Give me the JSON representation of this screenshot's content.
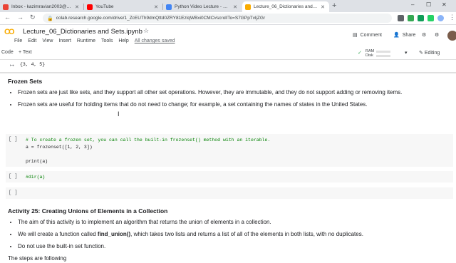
{
  "browser": {
    "tabs": [
      {
        "label": "Inbox - kazimravian2003@gmail...",
        "color": "#ea4335",
        "active": false
      },
      {
        "label": "YouTube",
        "color": "#ff0000",
        "active": false
      },
      {
        "label": "Python Video Lecture - Google D...",
        "color": "#4285f4",
        "active": false
      },
      {
        "label": "Lecture_06_Dictionaries and Se...",
        "color": "#f9ab00",
        "active": true
      }
    ],
    "url": "colab.research.google.com/drive/1_ZcEUTh9dmQttd0ZRY81EzlqWBxi0CMC#scrollTo=S7GPpTvljZGr"
  },
  "colab": {
    "title": "Lecture_06_Dictionaries and Sets.ipynb",
    "menus": [
      "File",
      "Edit",
      "View",
      "Insert",
      "Runtime",
      "Tools",
      "Help"
    ],
    "saved": "All changes saved",
    "comment": "Comment",
    "share": "Share",
    "code_btn": "Code",
    "text_btn": "+ Text",
    "ram": "RAM",
    "disk": "Disk",
    "editing": "Editing"
  },
  "cells": {
    "output": "{3, 4, 5}",
    "frozen_heading": "Frozen Sets",
    "frozen_b1": "Frozen sets are just like sets, and they support all other set operations. However, they are immutable, and they do not support adding or removing items.",
    "frozen_b2": "Frozen sets are useful for holding items that do not need to change; for example, a set containing the names of states in the United States.",
    "code1_comment": "# To create a frozen set, you can call the built-in frozenset() method with an iterable.",
    "code1_l2": "a = frozenset([1, 2, 3])",
    "code1_l3": "print(a)",
    "code2": "#dir(a)",
    "run_label": "[ ]",
    "activity_heading": "Activity 25: Creating Unions of Elements in a Collection",
    "act_b1": "The aim of this activity is to implement an algorithm that returns the union of elements in a collection.",
    "act_b2_pre": "We will create a function called ",
    "act_b2_bold": "find_union()",
    "act_b2_post": ", which takes two lists and returns a list of all of the elements in both lists, with no duplicates.",
    "act_b3": "Do not use the built-in set function.",
    "steps": "The steps are following"
  }
}
